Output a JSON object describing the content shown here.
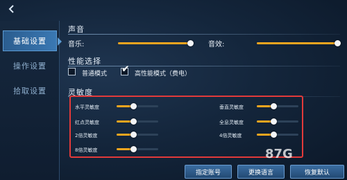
{
  "sidebar": {
    "items": [
      {
        "label": "基础设置",
        "active": true
      },
      {
        "label": "操作设置",
        "active": false
      },
      {
        "label": "拾取设置",
        "active": false
      }
    ]
  },
  "sound": {
    "title": "声音",
    "music_label": "音乐:",
    "music_level": 1.0,
    "sfx_label": "音效:",
    "sfx_level": 1.0
  },
  "performance": {
    "title": "性能选择",
    "normal_label": "普通模式",
    "normal_checked": false,
    "high_label": "高性能模式（费电）",
    "high_checked": true
  },
  "sensitivity": {
    "title": "灵敏度",
    "items": [
      {
        "label": "水平灵敏度",
        "level": 0.4
      },
      {
        "label": "垂直灵敏度",
        "level": 0.4
      },
      {
        "label": "红点灵敏度",
        "level": 0.4
      },
      {
        "label": "全息灵敏度",
        "level": 0.4
      },
      {
        "label": "2倍灵敏度",
        "level": 0.4
      },
      {
        "label": "4倍灵敏度",
        "level": 0.4
      },
      {
        "label": "8倍灵敏度",
        "level": 0.4
      }
    ],
    "highlight_color": "#e33a3a"
  },
  "buttons": {
    "account": "指定账号",
    "language": "更换语言",
    "reset": "恢复默认"
  },
  "watermark": "87G",
  "colors": {
    "accent": "#f2a51f",
    "sidebar_active": "#3a78b3"
  }
}
